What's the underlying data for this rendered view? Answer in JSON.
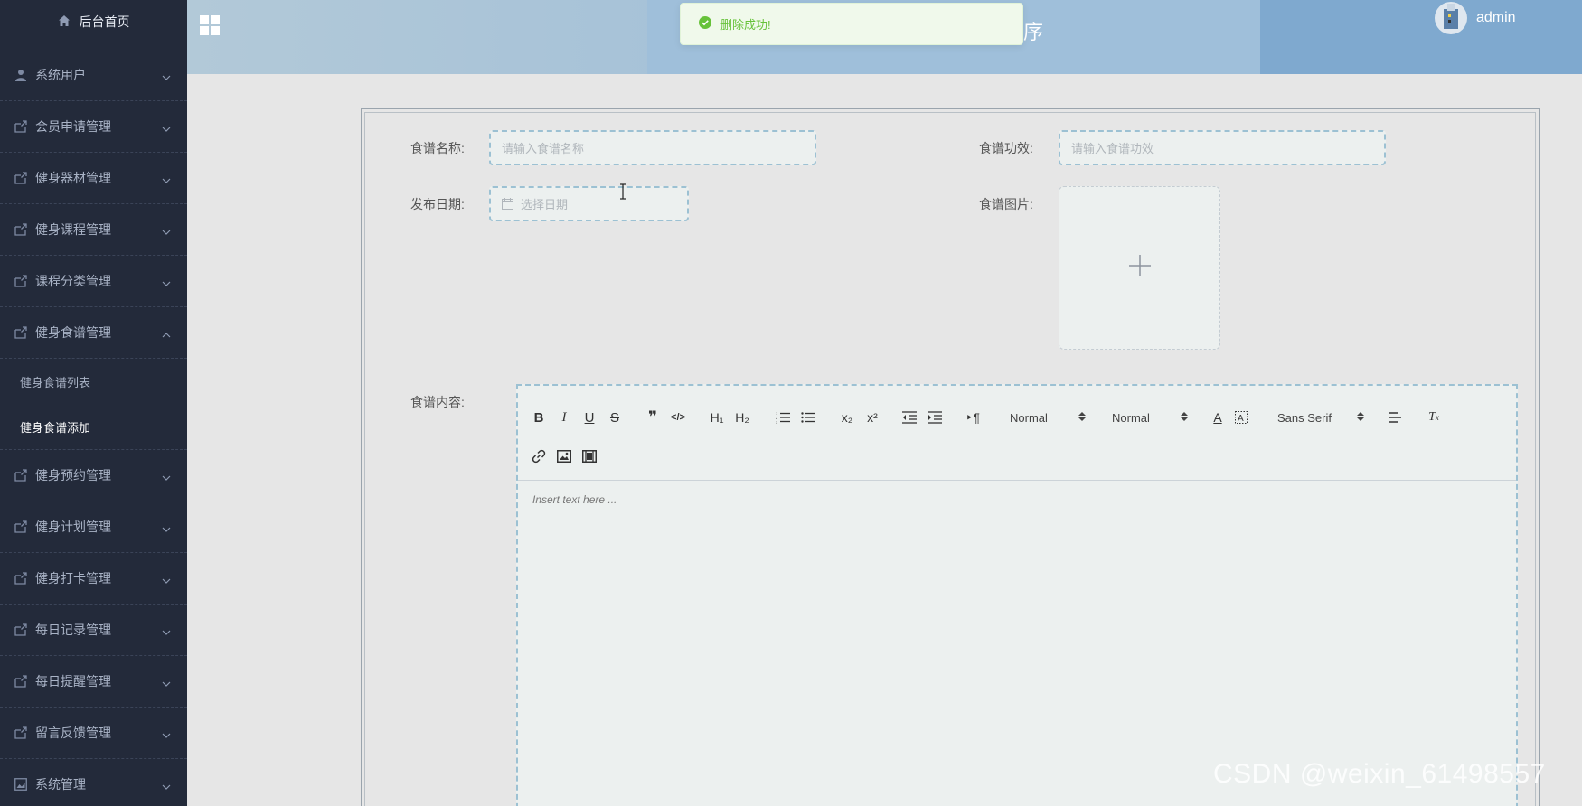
{
  "sidebar": {
    "home_label": "后台首页",
    "items": [
      {
        "label": "系统用户",
        "icon": "user-icon"
      },
      {
        "label": "会员申请管理",
        "icon": "folder-icon"
      },
      {
        "label": "健身器材管理",
        "icon": "folder-icon"
      },
      {
        "label": "健身课程管理",
        "icon": "folder-icon"
      },
      {
        "label": "课程分类管理",
        "icon": "folder-icon"
      },
      {
        "label": "健身食谱管理",
        "icon": "folder-icon",
        "expanded": true
      }
    ],
    "submenu": [
      {
        "label": "健身食谱列表",
        "active": false
      },
      {
        "label": "健身食谱添加",
        "active": true
      }
    ],
    "items_after": [
      {
        "label": "健身预约管理",
        "icon": "folder-icon"
      },
      {
        "label": "健身计划管理",
        "icon": "folder-icon"
      },
      {
        "label": "健身打卡管理",
        "icon": "folder-icon"
      },
      {
        "label": "每日记录管理",
        "icon": "folder-icon"
      },
      {
        "label": "每日提醒管理",
        "icon": "folder-icon"
      },
      {
        "label": "留言反馈管理",
        "icon": "folder-icon"
      },
      {
        "label": "系统管理",
        "icon": "image-icon"
      }
    ]
  },
  "header": {
    "title_fragment": "序",
    "user_name": "admin"
  },
  "toast": {
    "message": "删除成功!",
    "type": "success"
  },
  "form": {
    "name_label": "食谱名称:",
    "name_placeholder": "请输入食谱名称",
    "effect_label": "食谱功效:",
    "effect_placeholder": "请输入食谱功效",
    "date_label": "发布日期:",
    "date_placeholder": "选择日期",
    "image_label": "食谱图片:",
    "content_label": "食谱内容:"
  },
  "editor": {
    "header_select": "Normal",
    "size_select": "Normal",
    "font_select": "Sans Serif",
    "placeholder": "Insert text here ..."
  },
  "watermark": "CSDN @weixin_61498557",
  "colors": {
    "sidebar_bg": "#232a3a",
    "success_green": "#67c23a",
    "dashed_border": "#9cc1d3"
  }
}
